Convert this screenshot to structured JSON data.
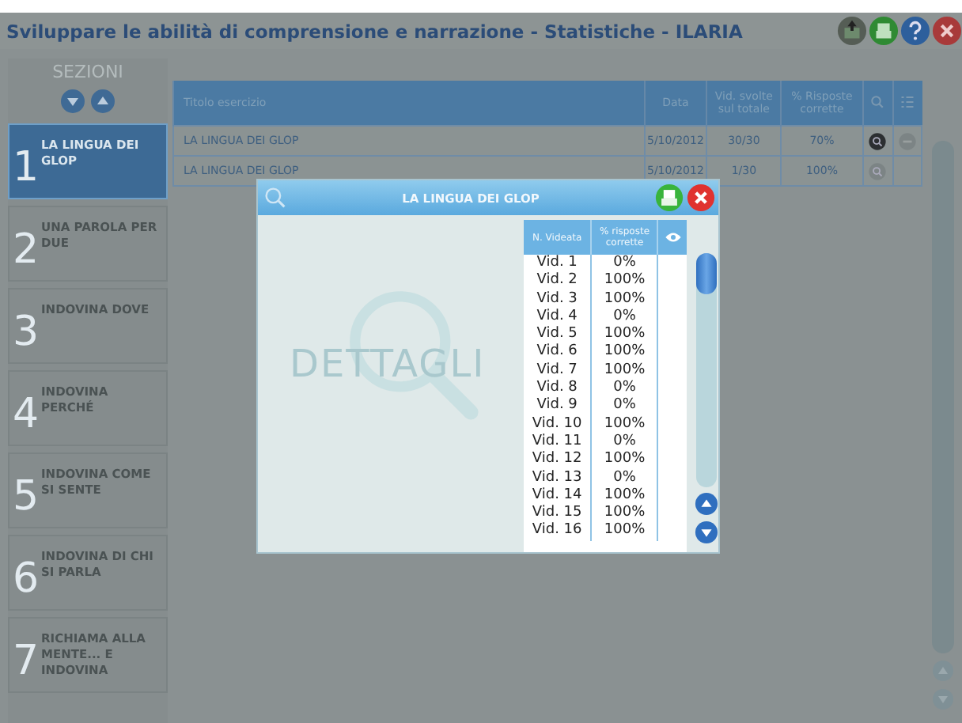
{
  "window": {
    "title": "Sviluppare le abilità di comprensione e narrazione - Statistiche - ILARIA"
  },
  "sidebar": {
    "title": "SEZIONI",
    "items": [
      {
        "number": "1",
        "label": "LA LINGUA DEI GLOP",
        "selected": true
      },
      {
        "number": "2",
        "label": "UNA PAROLA PER DUE",
        "selected": false
      },
      {
        "number": "3",
        "label": "INDOVINA DOVE",
        "selected": false
      },
      {
        "number": "4",
        "label": "INDOVINA PERCHÉ",
        "selected": false
      },
      {
        "number": "5",
        "label": "INDOVINA COME SI SENTE",
        "selected": false
      },
      {
        "number": "6",
        "label": "INDOVINA DI CHI SI PARLA",
        "selected": false
      },
      {
        "number": "7",
        "label": "RICHIAMA ALLA MENTE... E INDOVINA",
        "selected": false
      }
    ]
  },
  "table": {
    "columns": [
      "Titolo esercizio",
      "Data",
      "Vid. svolte sul totale",
      "% Risposte corrette"
    ],
    "rows": [
      {
        "cells": [
          "LA LINGUA DEI GLOP",
          "5/10/2012",
          "30/30",
          "70%"
        ],
        "detail_active": true,
        "removable": true
      },
      {
        "cells": [
          "LA LINGUA DEI GLOP",
          "5/10/2012",
          "1/30",
          "100%"
        ],
        "detail_active": false,
        "removable": false
      }
    ]
  },
  "dialog": {
    "title": "LA LINGUA DEI GLOP",
    "watermark": "DETTAGLI",
    "columns": [
      "N. Videata",
      "% risposte corrette"
    ],
    "rows": [
      [
        "Vid. 1",
        "0%"
      ],
      [
        "Vid. 2",
        "100%"
      ],
      [
        "Vid. 3",
        "100%"
      ],
      [
        "Vid. 4",
        "0%"
      ],
      [
        "Vid. 5",
        "100%"
      ],
      [
        "Vid. 6",
        "100%"
      ],
      [
        "Vid. 7",
        "100%"
      ],
      [
        "Vid. 8",
        "0%"
      ],
      [
        "Vid. 9",
        "0%"
      ],
      [
        "Vid. 10",
        "100%"
      ],
      [
        "Vid. 11",
        "0%"
      ],
      [
        "Vid. 12",
        "100%"
      ],
      [
        "Vid. 13",
        "0%"
      ],
      [
        "Vid. 14",
        "100%"
      ],
      [
        "Vid. 15",
        "100%"
      ],
      [
        "Vid. 16",
        "100%"
      ]
    ]
  }
}
